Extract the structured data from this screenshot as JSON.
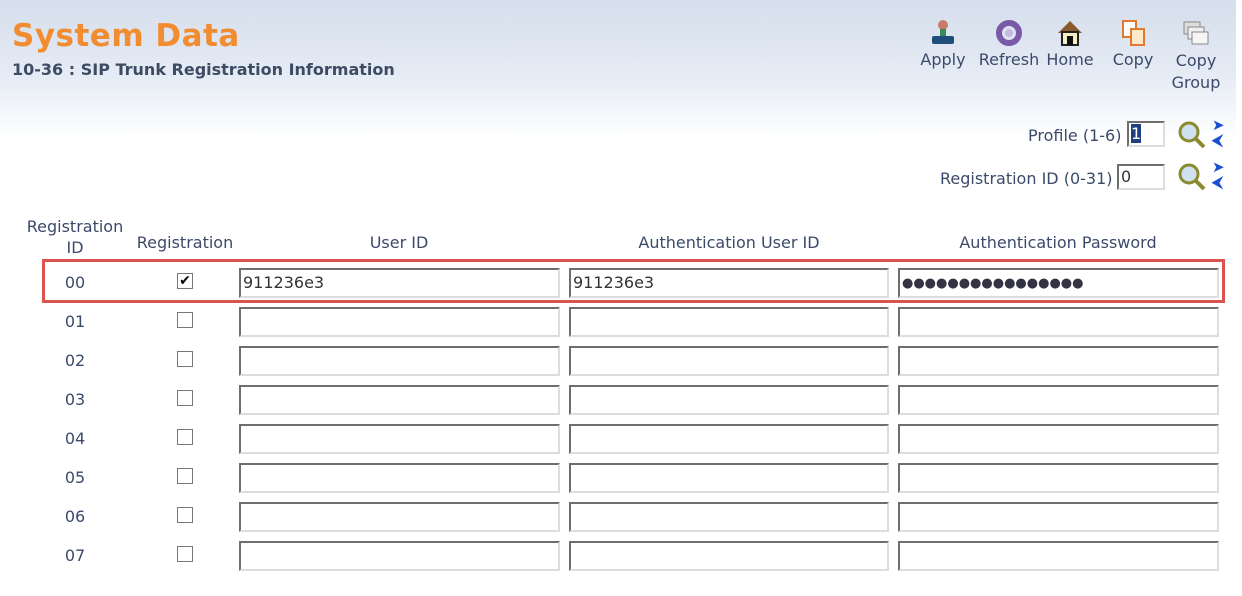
{
  "header": {
    "title": "System Data",
    "subtitle": "10-36 : SIP Trunk Registration Information"
  },
  "toolbar": [
    {
      "label": "Apply",
      "icon": "stamp-icon"
    },
    {
      "label": "Refresh",
      "icon": "refresh-icon"
    },
    {
      "label": "Home",
      "icon": "home-icon"
    },
    {
      "label": "Copy",
      "icon": "copy-icon"
    },
    {
      "label": "Copy Group",
      "icon": "copy-group-icon"
    }
  ],
  "profile": {
    "label": "Profile (1-6)",
    "value": "1"
  },
  "registration_id": {
    "label": "Registration ID (0-31)",
    "value": "0"
  },
  "table": {
    "headers": [
      "Registration ID",
      "Registration",
      "User ID",
      "Authentication User ID",
      "Authentication Password"
    ],
    "rows": [
      {
        "id": "00",
        "checked": true,
        "user_id": "911236e3",
        "auth_user_id": "911236e3",
        "password": "●●●●●●●●●●●●●●●●"
      },
      {
        "id": "01",
        "checked": false,
        "user_id": "",
        "auth_user_id": "",
        "password": ""
      },
      {
        "id": "02",
        "checked": false,
        "user_id": "",
        "auth_user_id": "",
        "password": ""
      },
      {
        "id": "03",
        "checked": false,
        "user_id": "",
        "auth_user_id": "",
        "password": ""
      },
      {
        "id": "04",
        "checked": false,
        "user_id": "",
        "auth_user_id": "",
        "password": ""
      },
      {
        "id": "05",
        "checked": false,
        "user_id": "",
        "auth_user_id": "",
        "password": ""
      },
      {
        "id": "06",
        "checked": false,
        "user_id": "",
        "auth_user_id": "",
        "password": ""
      },
      {
        "id": "07",
        "checked": false,
        "user_id": "",
        "auth_user_id": "",
        "password": ""
      }
    ]
  }
}
